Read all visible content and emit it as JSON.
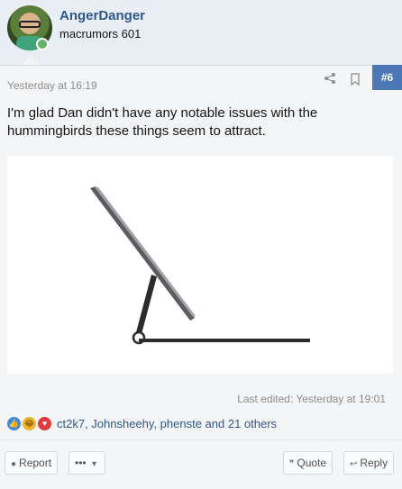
{
  "user": {
    "name": "AngerDanger",
    "title": "macrumors 601"
  },
  "post": {
    "timestamp": "Yesterday at 16:19",
    "number": "#6",
    "text": "I'm glad Dan didn't have any notable issues with the hummingbirds these things seem to attract.",
    "last_edited": "Last edited: Yesterday at 19:01"
  },
  "reactions": {
    "icons": [
      "like-reaction-icon",
      "haha-reaction-icon",
      "love-reaction-icon"
    ],
    "users_text": "ct2k7, Johnsheehy, phenste and 21 others"
  },
  "actions": {
    "report": "Report",
    "more": "•••",
    "quote": "Quote",
    "reply": "Reply"
  },
  "colors": {
    "accent": "#4c78b8",
    "link": "#2f568a",
    "online": "#63b265"
  }
}
